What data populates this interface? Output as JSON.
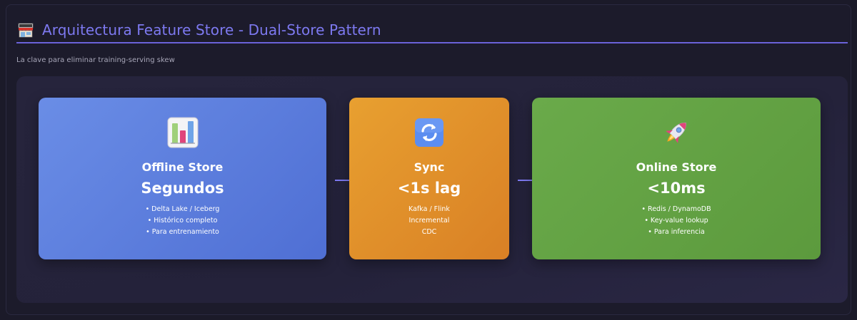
{
  "header": {
    "title": "Arquitectura Feature Store - Dual-Store Pattern",
    "icon": "store-icon",
    "subtitle": "La clave para eliminar training-serving skew"
  },
  "colors": {
    "accent": "#7d79f0",
    "offline": "#5b7fdd",
    "sync": "#e39029",
    "online": "#64a244"
  },
  "cards": [
    {
      "icon": "bar-chart-icon",
      "title": "Offline Store",
      "metric": "Segundos",
      "items": [
        "• Delta Lake / Iceberg",
        "• Histórico completo",
        "• Para entrenamiento"
      ]
    },
    {
      "icon": "sync-icon",
      "title": "Sync",
      "metric": "<1s lag",
      "items": [
        "Kafka / Flink",
        "Incremental",
        "CDC"
      ]
    },
    {
      "icon": "rocket-icon",
      "title": "Online Store",
      "metric": "<10ms",
      "items": [
        "• Redis / DynamoDB",
        "• Key-value lookup",
        "• Para inferencia"
      ]
    }
  ]
}
